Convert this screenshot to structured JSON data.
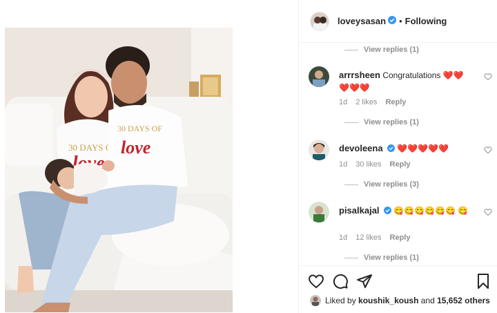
{
  "post": {
    "author": "loveysasan",
    "follow_state": "Following",
    "dot": "•"
  },
  "comments": [
    {
      "user": "arrrsheen",
      "text": "Congratulations ❤️❤️ ❤️❤️❤️",
      "age": "1d",
      "likes": "2 likes",
      "reply": "Reply",
      "view_replies": "View replies (1)"
    },
    {
      "user": "devoleena",
      "verified": true,
      "text": "❤️❤️❤️❤️❤️",
      "age": "1d",
      "likes": "30 likes",
      "reply": "Reply",
      "view_replies": "View replies (3)"
    },
    {
      "user": "pisalkajal",
      "verified": true,
      "text": "😋😋😋😋😋😋 😋",
      "age": "1d",
      "likes": "12 likes",
      "reply": "Reply",
      "view_replies": "View replies (1)"
    }
  ],
  "top_view_replies": "View replies (1)",
  "liked_by": {
    "prefix": "Liked by",
    "user": "koushik_koush",
    "and": "and",
    "count": "15,652 others"
  },
  "colors": {
    "verified": "#3897f0",
    "muted": "#8e8e8e",
    "heart_red": "#ed2f2f"
  },
  "icons": [
    "verified-badge-icon",
    "like-heart-icon",
    "comment-icon",
    "share-icon",
    "save-bookmark-icon"
  ]
}
